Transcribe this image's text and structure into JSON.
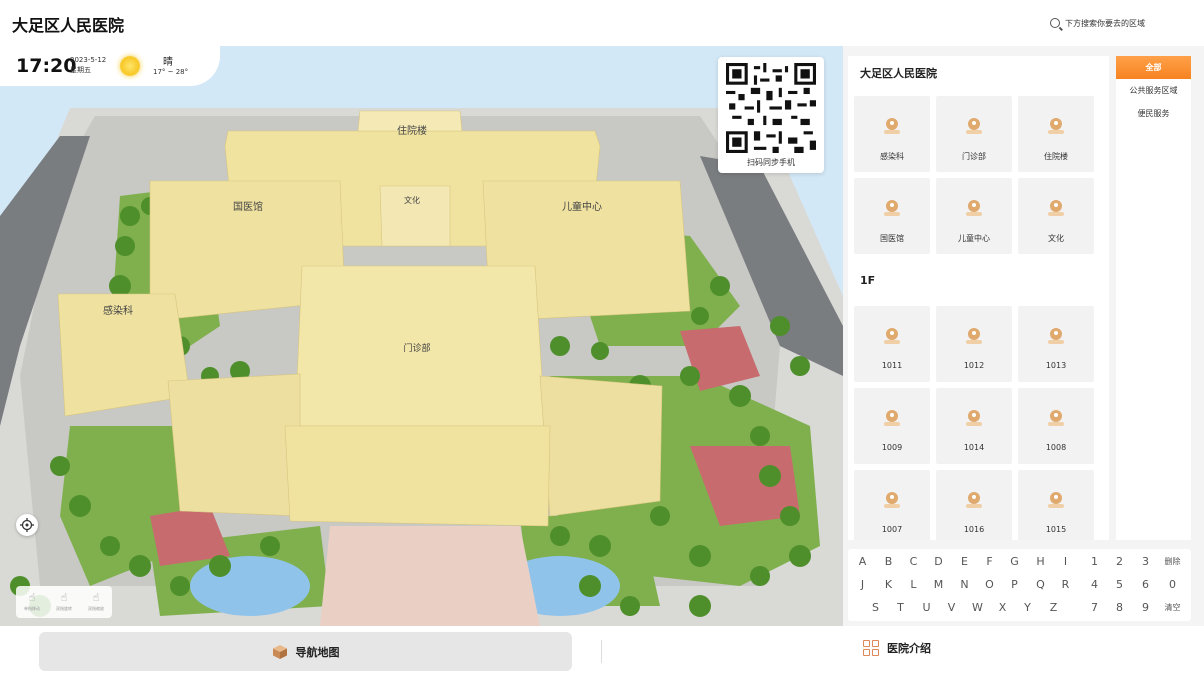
{
  "header": {
    "title": "大足区人民医院",
    "search_placeholder": "下方搜索你要去的区域"
  },
  "status": {
    "time": "17:20",
    "date": "2023-5-12",
    "weekday": "星期五",
    "condition": "晴",
    "temperature": "17° ~ 28°"
  },
  "map": {
    "buildings": {
      "inpatient": "住院楼",
      "culture": "文化",
      "tcm": "国医馆",
      "children": "儿童中心",
      "infection": "感染科",
      "outpatient": "门诊部"
    },
    "qr_label": "扫码同步手机",
    "gestures": [
      "单指移动",
      "双指旋转",
      "双指缩放"
    ]
  },
  "panel": {
    "section1_title": "大足区人民医院",
    "section1_items": [
      "感染科",
      "门诊部",
      "住院楼",
      "国医馆",
      "儿童中心",
      "文化"
    ],
    "section2_title": "1F",
    "section2_items": [
      "1011",
      "1012",
      "1013",
      "1009",
      "1014",
      "1008",
      "1007",
      "1016",
      "1015"
    ]
  },
  "categories": [
    "全部",
    "公共服务区域",
    "便民服务"
  ],
  "keyboard": {
    "row1": [
      "A",
      "B",
      "C",
      "D",
      "E",
      "F",
      "G",
      "H",
      "I"
    ],
    "row2": [
      "J",
      "K",
      "L",
      "M",
      "N",
      "O",
      "P",
      "Q",
      "R"
    ],
    "row3": [
      "S",
      "T",
      "U",
      "V",
      "W",
      "X",
      "Y",
      "Z"
    ],
    "digits": [
      [
        "1",
        "2",
        "3"
      ],
      [
        "4",
        "5",
        "6"
      ],
      [
        "7",
        "8",
        "9"
      ]
    ],
    "delete": "删除",
    "zero": "0",
    "clear": "清空"
  },
  "nav": {
    "map_label": "导航地图",
    "intro_label": "医院介绍"
  },
  "colors": {
    "accent": "#f78321",
    "building": "#f0e3a0",
    "tree": "#4e8f2b"
  }
}
